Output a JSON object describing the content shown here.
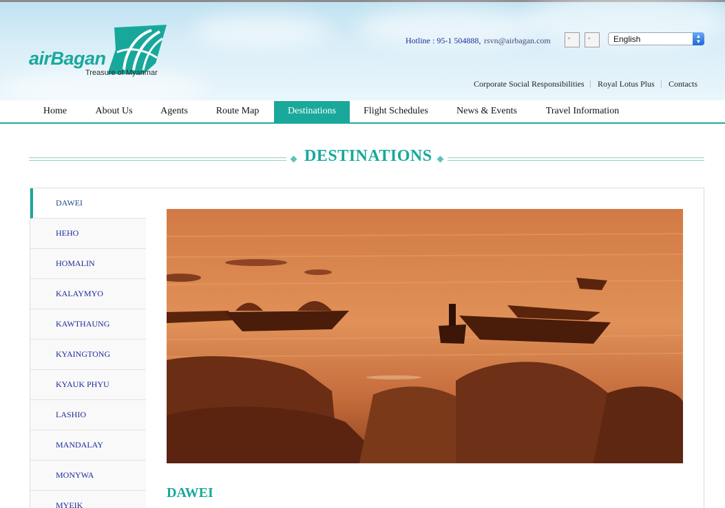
{
  "brand": {
    "logo_text": "airBagan",
    "tagline": "Treasure of Myanmar",
    "color": "#18a89b"
  },
  "header": {
    "hotline": "Hotline : 95-1 504888,",
    "email": "rsvn@airbagan.com",
    "image_buttons": [
      "broken-image-icon",
      "broken-image-icon"
    ],
    "language": {
      "selected": "English"
    },
    "util_links": [
      "Corporate Social Responsibilities",
      "Royal Lotus Plus",
      "Contacts"
    ],
    "separator": "|"
  },
  "nav": {
    "items": [
      "Home",
      "About Us",
      "Agents",
      "Route Map",
      "Destinations",
      "Flight Schedules",
      "News & Events",
      "Travel Information"
    ],
    "active": "Destinations",
    "active_color": "#1aa89b"
  },
  "page": {
    "title": "DESTINATIONS"
  },
  "sidebar": {
    "items": [
      "DAWEI",
      "HEHO",
      "HOMALIN",
      "KALAYMYO",
      "KAWTHAUNG",
      "KYAINGTONG",
      "KYAUK PHYU",
      "LASHIO",
      "MANDALAY",
      "MONYWA",
      "MYEIK"
    ],
    "active": "DAWEI"
  },
  "content": {
    "city_name": "DAWEI",
    "hero_image": "fishing-boats-at-sunset-photo"
  }
}
